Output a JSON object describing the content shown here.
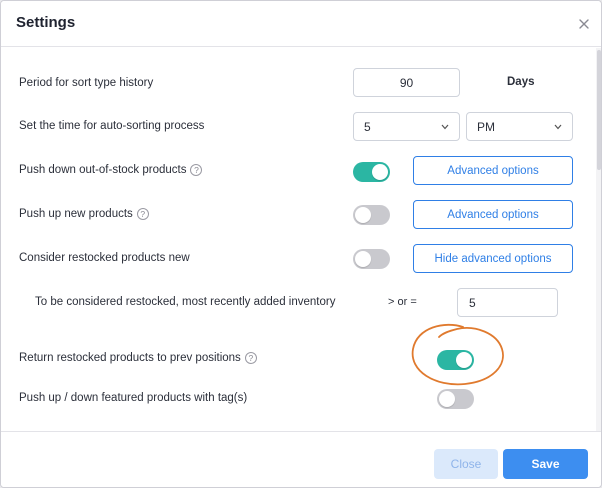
{
  "dialog": {
    "title": "Settings"
  },
  "icons": {
    "close": "close-icon",
    "help": "question-circle-icon",
    "chevron": "chevron-down-icon"
  },
  "colors": {
    "accent": "#2f7fe6",
    "toggle_on": "#2bb6a3",
    "toggle_off": "#c9c9ce",
    "annotation": "#e07a2e"
  },
  "settings": {
    "period": {
      "label": "Period for sort type history",
      "value": "90",
      "unit": "Days"
    },
    "auto_sort_time": {
      "label": "Set the time for auto-sorting process",
      "hour": "5",
      "ampm": "PM"
    },
    "push_down_oos": {
      "label": "Push down out-of-stock products",
      "help": "?",
      "enabled": true,
      "button": "Advanced options"
    },
    "push_up_new": {
      "label": "Push up new products",
      "help": "?",
      "enabled": false,
      "button": "Advanced options"
    },
    "restocked_new": {
      "label": "Consider restocked products new",
      "enabled": false,
      "button": "Hide advanced options"
    },
    "restocked_condition": {
      "label": "To be considered restocked, most recently added inventory",
      "operator": "> or =",
      "value": "5"
    },
    "return_restocked": {
      "label": "Return restocked products to prev positions",
      "help": "?",
      "enabled": true
    },
    "featured_tags": {
      "label": "Push up / down featured products with tag(s)",
      "enabled": false
    }
  },
  "footer": {
    "close_label": "Close",
    "save_label": "Save"
  }
}
